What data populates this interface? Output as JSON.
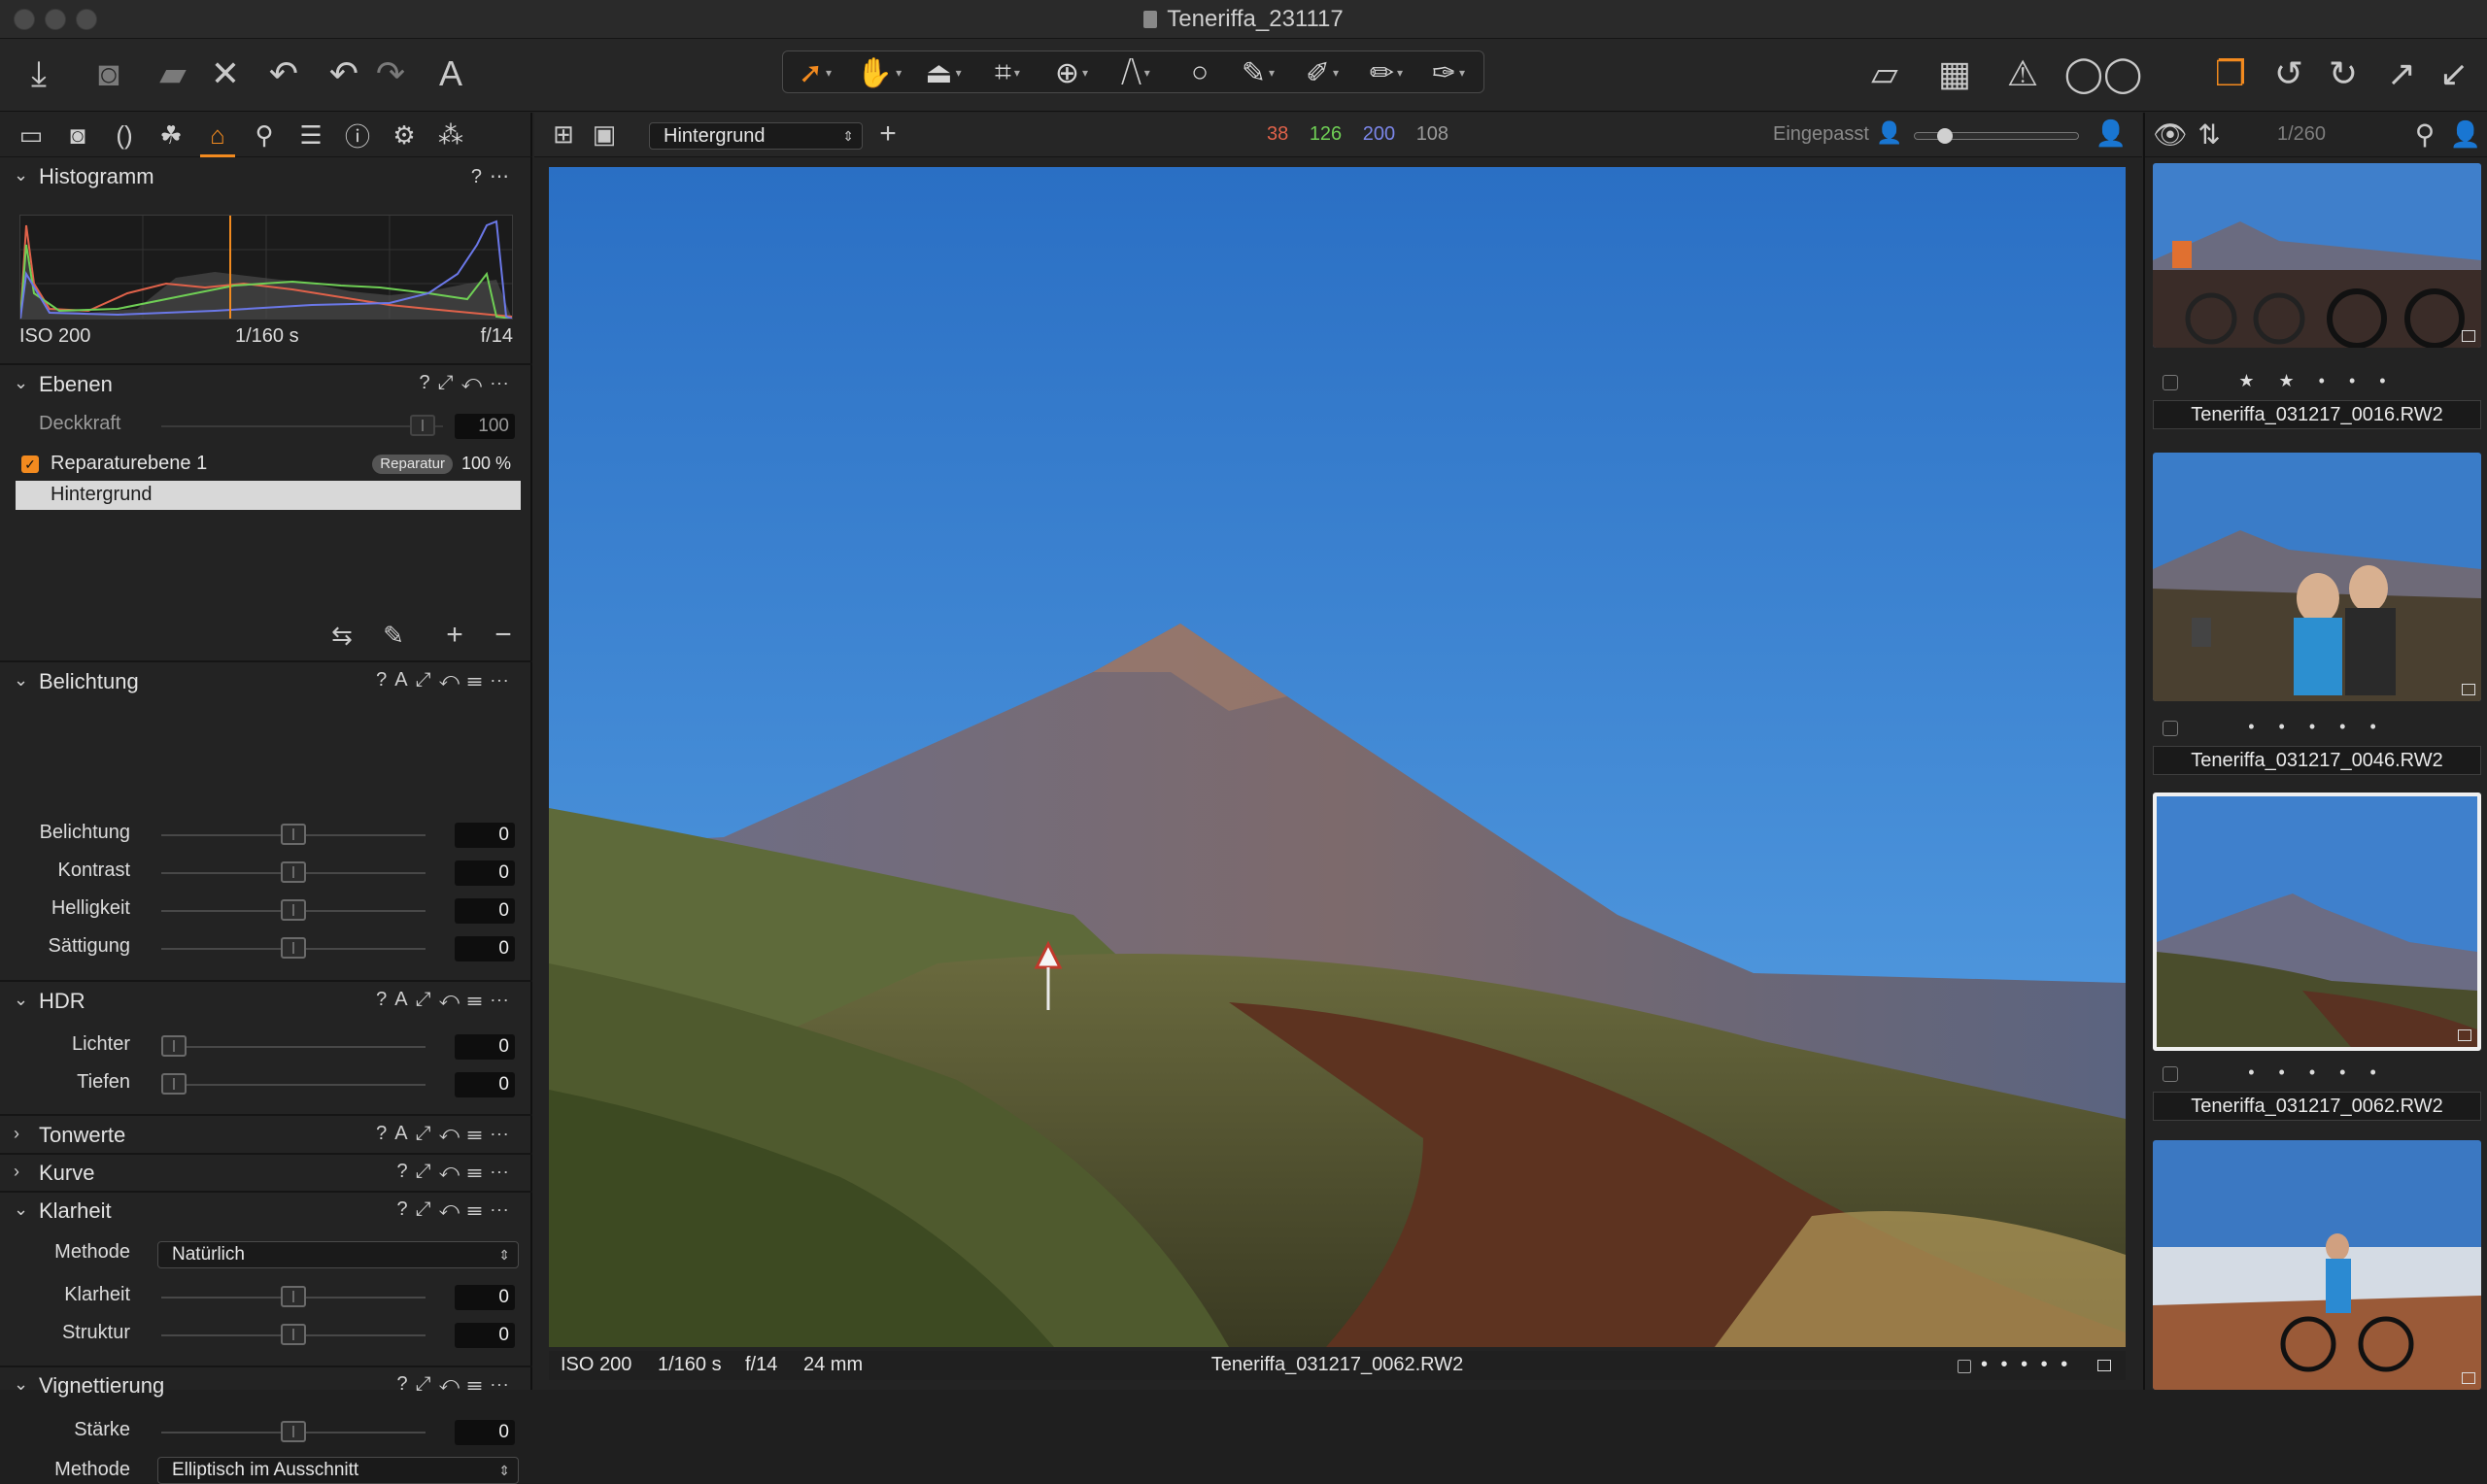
{
  "window": {
    "title": "Teneriffa_231117"
  },
  "toolbar": {
    "left_icons": [
      "import-icon",
      "camera-icon",
      "export-folder-icon",
      "delete-icon",
      "undo-all-icon",
      "undo-icon",
      "redo-icon",
      "text-icon"
    ],
    "cursor_tools": [
      "select-cursor-icon",
      "pan-hand-icon",
      "viewer-icon",
      "crop-icon",
      "rotate-icon",
      "keystone-icon",
      "circle-icon",
      "brush-icon",
      "picker-icon",
      "eraser-icon",
      "annotate-icon"
    ],
    "right_icons": [
      "overlay-icon",
      "grid-icon",
      "exposure-warning-icon",
      "proof-glasses-icon",
      "multi-view-icon",
      "rotate-left-icon",
      "rotate-right-icon",
      "expand-icon",
      "collapse-icon"
    ]
  },
  "left_panel": {
    "tool_tabs": [
      "library-icon",
      "capture-icon",
      "lens-icon",
      "color-icon",
      "exposure-icon",
      "detail-icon",
      "adjustments-icon",
      "metadata-icon",
      "output-icon",
      "batch-icon"
    ],
    "histogram": {
      "title": "Histogramm",
      "iso": "ISO 200",
      "shutter": "1/160 s",
      "aperture": "f/14"
    },
    "layers": {
      "title": "Ebenen",
      "opacity_label": "Deckkraft",
      "opacity_value": "100",
      "items": [
        {
          "name": "Reparaturebene 1",
          "badge": "Reparatur",
          "opacity": "100 %",
          "checked": true
        },
        {
          "name": "Hintergrund",
          "selected": true
        }
      ]
    },
    "exposure": {
      "title": "Belichtung",
      "rows": [
        {
          "label": "Belichtung",
          "value": "0",
          "level": 0.5
        },
        {
          "label": "Kontrast",
          "value": "0",
          "level": 0.5
        },
        {
          "label": "Helligkeit",
          "value": "0",
          "level": 0.5
        },
        {
          "label": "Sättigung",
          "value": "0",
          "level": 0.5
        }
      ]
    },
    "hdr": {
      "title": "HDR",
      "rows": [
        {
          "label": "Lichter",
          "value": "0",
          "level": 0
        },
        {
          "label": "Tiefen",
          "value": "0",
          "level": 0
        }
      ]
    },
    "levels": {
      "title": "Tonwerte"
    },
    "curve": {
      "title": "Kurve"
    },
    "clarity": {
      "title": "Klarheit",
      "method_label": "Methode",
      "method_value": "Natürlich",
      "rows": [
        {
          "label": "Klarheit",
          "value": "0",
          "level": 0.5
        },
        {
          "label": "Struktur",
          "value": "0",
          "level": 0.5
        }
      ]
    },
    "vignette": {
      "title": "Vignettierung",
      "strength_label": "Stärke",
      "strength_value": "0",
      "strength_level": 0.5,
      "method_label": "Methode",
      "method_value": "Elliptisch im Ausschnitt"
    }
  },
  "viewer": {
    "layer_select": "Hintergrund",
    "rgb": {
      "r": "38",
      "g": "126",
      "b": "200",
      "l": "108"
    },
    "colors": {
      "r": "#e0624a",
      "g": "#6fcf55",
      "b": "#7b86e8",
      "l": "#9a9a9a"
    },
    "zoom_label": "Eingepasst",
    "zoom_level": 0.15,
    "status": {
      "iso": "ISO 200",
      "shutter": "1/160 s",
      "aperture": "f/14",
      "focal": "24 mm",
      "filename": "Teneriffa_031217_0062.RW2",
      "rating": "• • • • •"
    }
  },
  "browser": {
    "count": "1/260",
    "items": [
      {
        "filename": "Teneriffa_031217_0016.RW2",
        "rating": "★ ★ • • •",
        "selected": false
      },
      {
        "filename": "Teneriffa_031217_0046.RW2",
        "rating": "• • • • •",
        "selected": false
      },
      {
        "filename": "Teneriffa_031217_0062.RW2",
        "rating": "• • • • •",
        "selected": true
      }
    ]
  },
  "accent_color": "#f28a1f"
}
